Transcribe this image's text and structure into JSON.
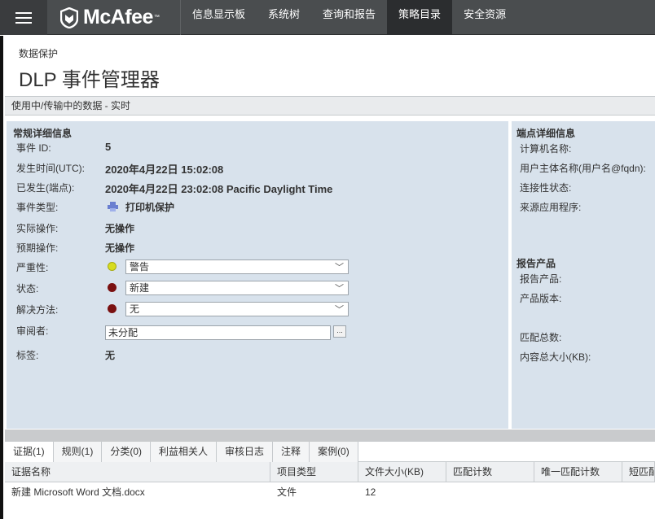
{
  "nav": {
    "brand": "McAfee",
    "items": [
      "信息显示板",
      "系统树",
      "查询和报告",
      "策略目录",
      "安全资源"
    ]
  },
  "page": {
    "breadcrumb": "数据保护",
    "title": "DLP 事件管理器",
    "subheader": "使用中/传输中的数据 - 实时"
  },
  "general": {
    "title": "常规详细信息",
    "event_id_label": "事件 ID:",
    "event_id": "5",
    "time_utc_label": "发生时间(UTC):",
    "time_utc": "2020年4月22日 15:02:08",
    "time_endpoint_label": "已发生(端点):",
    "time_endpoint": "2020年4月22日 23:02:08 Pacific Daylight Time",
    "event_type_label": "事件类型:",
    "event_type": "打印机保护",
    "actual_action_label": "实际操作:",
    "actual_action": "无操作",
    "expected_action_label": "预期操作:",
    "expected_action": "无操作",
    "severity_label": "严重性:",
    "severity": "警告",
    "status_label": "状态:",
    "status": "新建",
    "resolution_label": "解决方法:",
    "resolution": "无",
    "reviewer_label": "审阅者:",
    "reviewer": "未分配",
    "reviewer_button": "...",
    "tags_label": "标签:",
    "tags": "无"
  },
  "endpoint": {
    "title": "端点详细信息",
    "computer_name": "计算机名称:",
    "user_principal": "用户主体名称(用户名@fqdn):",
    "connectivity": "连接性状态:",
    "source_app": "来源应用程序:"
  },
  "report": {
    "title": "报告产品",
    "product": "报告产品:",
    "version": "产品版本:",
    "match_count": "匹配总数:",
    "content_size": "内容总大小(KB):"
  },
  "tabs": [
    "证据(1)",
    "规则(1)",
    "分类(0)",
    "利益相关人",
    "审核日志",
    "注释",
    "案例(0)"
  ],
  "table": {
    "headers": [
      "证据名称",
      "项目类型",
      "文件大小(KB)",
      "匹配计数",
      "唯一匹配计数",
      "短匹配"
    ],
    "rows": [
      [
        "新建 Microsoft Word 文档.docx",
        "文件",
        "12",
        "",
        "",
        ""
      ]
    ]
  },
  "colors": {
    "severity_dot": "#d7dc1f",
    "status_dot": "#7a1010",
    "resolution_dot": "#7a1010",
    "printer_icon": "#6a7fd0"
  }
}
